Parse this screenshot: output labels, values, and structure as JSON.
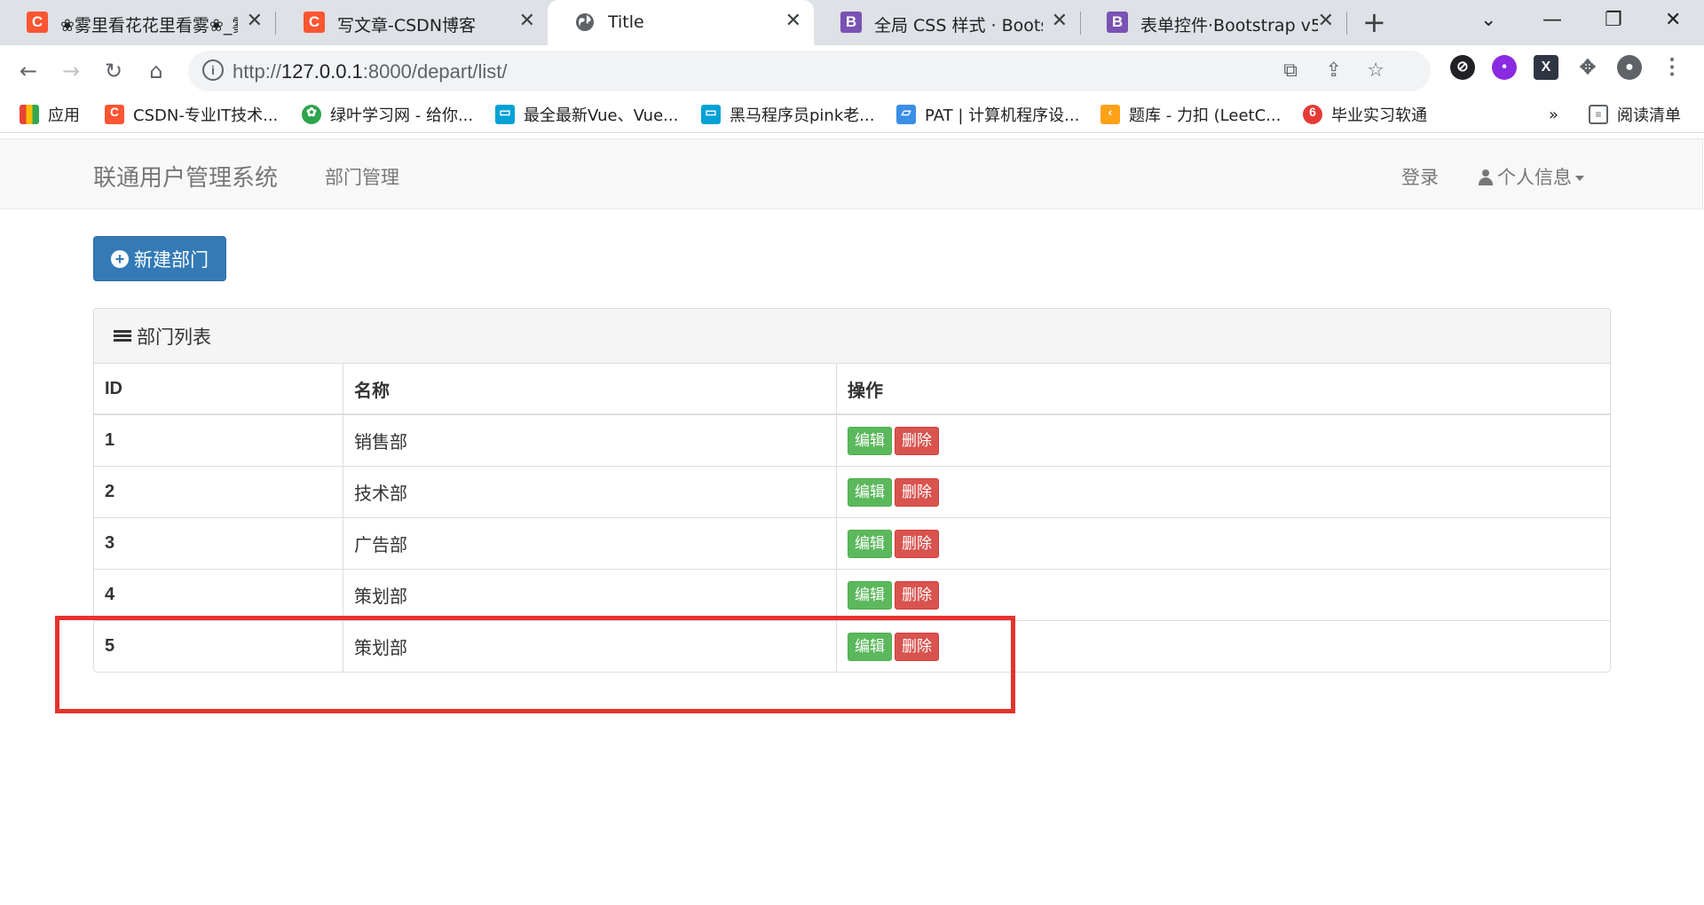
{
  "browser": {
    "tabs": [
      {
        "title": "❀雾里看花花里看雾❀_雾",
        "favicon": "csdn-icon",
        "active": false
      },
      {
        "title": "写文章-CSDN博客",
        "favicon": "csdn-icon",
        "active": false
      },
      {
        "title": "Title",
        "favicon": "globe-icon",
        "active": true
      },
      {
        "title": "全局 CSS 样式 · Bootstrap",
        "favicon": "bootstrap-icon",
        "active": false
      },
      {
        "title": "表单控件·Bootstrap v5.1",
        "favicon": "bootstrap-icon",
        "active": false
      }
    ],
    "url_prefix": "http://",
    "url_host": "127.0.0.1",
    "url_rest": ":8000/depart/list/",
    "bookmarks": [
      {
        "label": "应用"
      },
      {
        "label": "CSDN-专业IT技术..."
      },
      {
        "label": "绿叶学习网 - 给你..."
      },
      {
        "label": "最全最新Vue、Vue..."
      },
      {
        "label": "黑马程序员pink老..."
      },
      {
        "label": "PAT | 计算机程序设..."
      },
      {
        "label": "题库 - 力扣 (LeetC..."
      },
      {
        "label": "毕业实习软通"
      }
    ],
    "bookmarks_more": "»",
    "reading_list": "阅读清单",
    "colors": {
      "csdn": "#fc5531",
      "bootstrap": "#7952b3",
      "highlight": "#e5322d"
    }
  },
  "navbar": {
    "brand": "联通用户管理系统",
    "dept_link": "部门管理",
    "login": "登录",
    "profile": "个人信息"
  },
  "page": {
    "new_button": "新建部门",
    "panel_title": "部门列表",
    "columns": [
      "ID",
      "名称",
      "操作"
    ],
    "rows": [
      {
        "id": "1",
        "name": "销售部"
      },
      {
        "id": "2",
        "name": "技术部"
      },
      {
        "id": "3",
        "name": "广告部"
      },
      {
        "id": "4",
        "name": "策划部"
      },
      {
        "id": "5",
        "name": "策划部"
      }
    ],
    "edit_label": "编辑",
    "delete_label": "删除"
  }
}
